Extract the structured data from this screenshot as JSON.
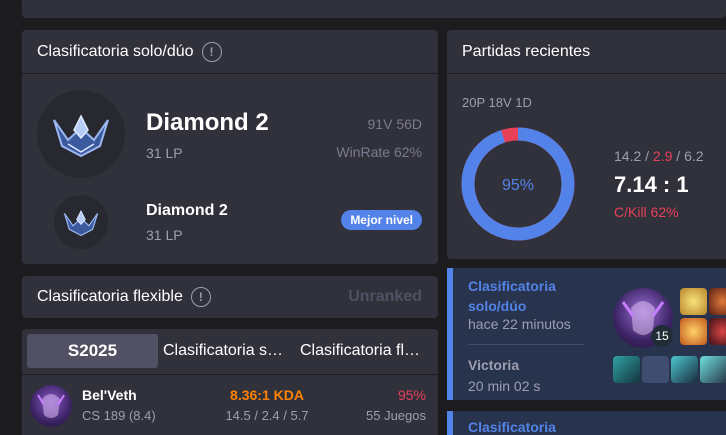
{
  "solo": {
    "title": "Clasificatoria solo/dúo",
    "current": {
      "tier": "Diamond 2",
      "lp": "31 LP",
      "record": "91V 56D",
      "winrate": "WinRate 62%"
    },
    "peak": {
      "tier": "Diamond 2",
      "lp": "31 LP",
      "badge": "Mejor nivel"
    }
  },
  "flex": {
    "title": "Clasificatoria flexible",
    "status": "Unranked"
  },
  "season": {
    "tabs": [
      "S2025",
      "Clasificatoria s…",
      "Clasificatoria fl…"
    ],
    "rows": [
      {
        "champion": "Bel'Veth",
        "cs": "CS 189 (8.4)",
        "kda_ratio": "8.36:1 KDA",
        "kda": "14.5 / 2.4 / 5.7",
        "winrate": "95%",
        "games": "55 Juegos"
      }
    ]
  },
  "recent": {
    "title": "Partidas recientes",
    "summary": "20P 18V 1D",
    "donut_label": "95%",
    "win_fraction": 0.95,
    "kills": "14.2",
    "sep": " / ",
    "deaths": "2.9",
    "assists": "6.2",
    "kda": "7.14 : 1",
    "ckill": "C/Kill 62%"
  },
  "games": [
    {
      "queue_line1": "Clasificatoria",
      "queue_line2": "solo/dúo",
      "ago": "hace 22 minutos",
      "result": "Victoria",
      "duration": "20 min 02 s",
      "level": "15"
    },
    {
      "queue_line1": "Clasificatoria"
    }
  ],
  "colors": {
    "accent": "#5383e8",
    "loss": "#e84057",
    "kda_gold": "#ff8200",
    "card": "#31313c",
    "bg": "#1c1c1f"
  }
}
